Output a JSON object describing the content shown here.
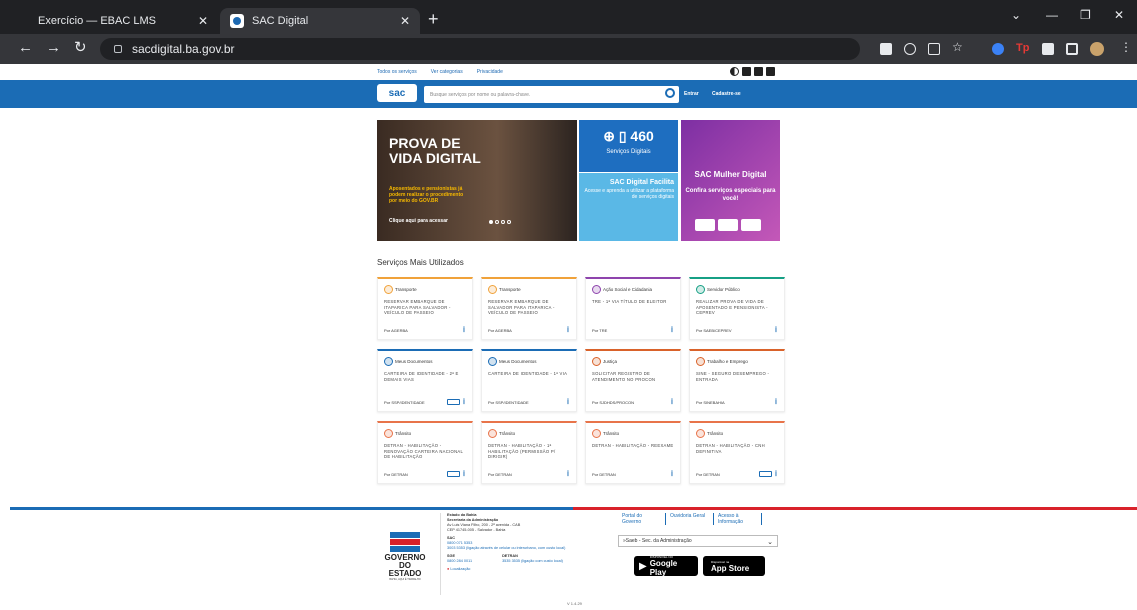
{
  "browser": {
    "tabs": [
      {
        "title": "Exercício — EBAC LMS",
        "active": false
      },
      {
        "title": "SAC Digital",
        "active": true
      }
    ],
    "url": "sacdigital.ba.gov.br"
  },
  "top_links": [
    "Todos os serviços",
    "Ver categorias",
    "Privacidade"
  ],
  "header": {
    "logo": "sac",
    "search_placeholder": "Busque serviços por nome ou palavra-chave.",
    "login": "Entrar",
    "register": "Cadastre-se"
  },
  "banners": {
    "main": {
      "title": "PROVA DE VIDA DIGITAL",
      "subtitle": "Aposentados e pensionistas já podem realizar o procedimento por meio do GOV.BR",
      "cta": "Clique aqui para acessar"
    },
    "services": {
      "count": "460",
      "label": "Serviços Digitais"
    },
    "facilita": {
      "title": "SAC Digital Facilita",
      "text": "Acesse e aprenda a utilizar a plataforma de serviços digitais"
    },
    "mulher": {
      "title": "SAC Mulher Digital",
      "text": "Confira serviços especiais para você!"
    }
  },
  "section_title": "Serviços Mais Utilizados",
  "cards": [
    {
      "category": "Transporte",
      "text": "RESERVAR EMBARQUE DE ITAPARICA PARA SALVADOR - VEÍCULO DE PASSEIO",
      "by": "Por AGERBA",
      "color": "#f0a23a"
    },
    {
      "category": "Transporte",
      "text": "RESERVAR EMBARQUE DE SALVADOR PARA ITAPARICA - VEÍCULO DE PASSEIO",
      "by": "Por AGERBA",
      "color": "#f0a23a"
    },
    {
      "category": "Ação Social e Cidadania",
      "text": "TRE - 1ª VIA TÍTULO DE ELEITOR",
      "by": "Por TRE",
      "color": "#8e44ad"
    },
    {
      "category": "Servidor Público",
      "text": "REALIZAR PROVA DE VIDA DE APOSENTADO E PENSIONISTA - CEPREV",
      "by": "Por SAEB/CEPREV",
      "color": "#16a085"
    },
    {
      "category": "Meus Documentos",
      "text": "CARTEIRA DE IDENTIDADE - 2ª E DEMAIS VIAS",
      "by": "Por SSP/IDENTIDADE",
      "color": "#1b6cb5"
    },
    {
      "category": "Meus Documentos",
      "text": "CARTEIRA DE IDENTIDADE - 1ª VIA",
      "by": "Por SSP/IDENTIDADE",
      "color": "#1b6cb5"
    },
    {
      "category": "Justiça",
      "text": "SOLICITAR REGISTRO DE ATENDIMENTO NO PROCON",
      "by": "Por SJDHDS/PROCON",
      "color": "#d9622a"
    },
    {
      "category": "Trabalho e Emprego",
      "text": "SINE - SEGURO DESEMPREGO - ENTRADA",
      "by": "Por SINEBAHIA",
      "color": "#d9622a"
    },
    {
      "category": "Trânsito",
      "text": "DETRAN - HABILITAÇÃO - RENOVAÇÃO CARTEIRA NACIONAL DE HABILITAÇÃO",
      "by": "Por DETRAN",
      "color": "#e8744a"
    },
    {
      "category": "Trânsito",
      "text": "DETRAN - HABILITAÇÃO - 1ª HABILITAÇÃO (PERMISSÃO P/ DIRIGIR)",
      "by": "Por DETRAN",
      "color": "#e8744a"
    },
    {
      "category": "Trânsito",
      "text": "DETRAN - HABILITAÇÃO - REEXAME",
      "by": "Por DETRAN",
      "color": "#e8744a"
    },
    {
      "category": "Trânsito",
      "text": "DETRAN - HABILITAÇÃO - CNH DEFINITIVA",
      "by": "Por DETRAN",
      "color": "#e8744a"
    }
  ],
  "footer": {
    "gov_name": "GOVERNO DO ESTADO",
    "gov_tagline": "BAHIA, AQUI É TRABALHO",
    "info": {
      "l1": "Estado da Bahia",
      "l2": "Secretaria da Administração",
      "l3": "Av Luis Viana Filho, 200 - 2ª avenida - CAB",
      "l4": "CEP 41745-005 - Salvador - Bahia",
      "sac": "SAC",
      "sac_phone1": "0800 071 5353",
      "sac_phone2": "3003 5353 (ligação através de celular ou interurbano, com custo local)",
      "sge": "SGE",
      "sge_phone": "0800 284 0011",
      "detran": "DETRAN",
      "detran_phone": "3535 3535 (ligação com custo local)",
      "location": "Localização"
    },
    "links": [
      "Portal do Governo",
      "Ouvidoria Geral",
      "Acesso à Informação"
    ],
    "select": "»Saeb - Sec. da Administração",
    "google_small": "DISPONÍVEL NO",
    "google_big": "Google Play",
    "apple_small": "Disponível na",
    "apple_big": "App Store",
    "version": "V 1.4.29"
  }
}
